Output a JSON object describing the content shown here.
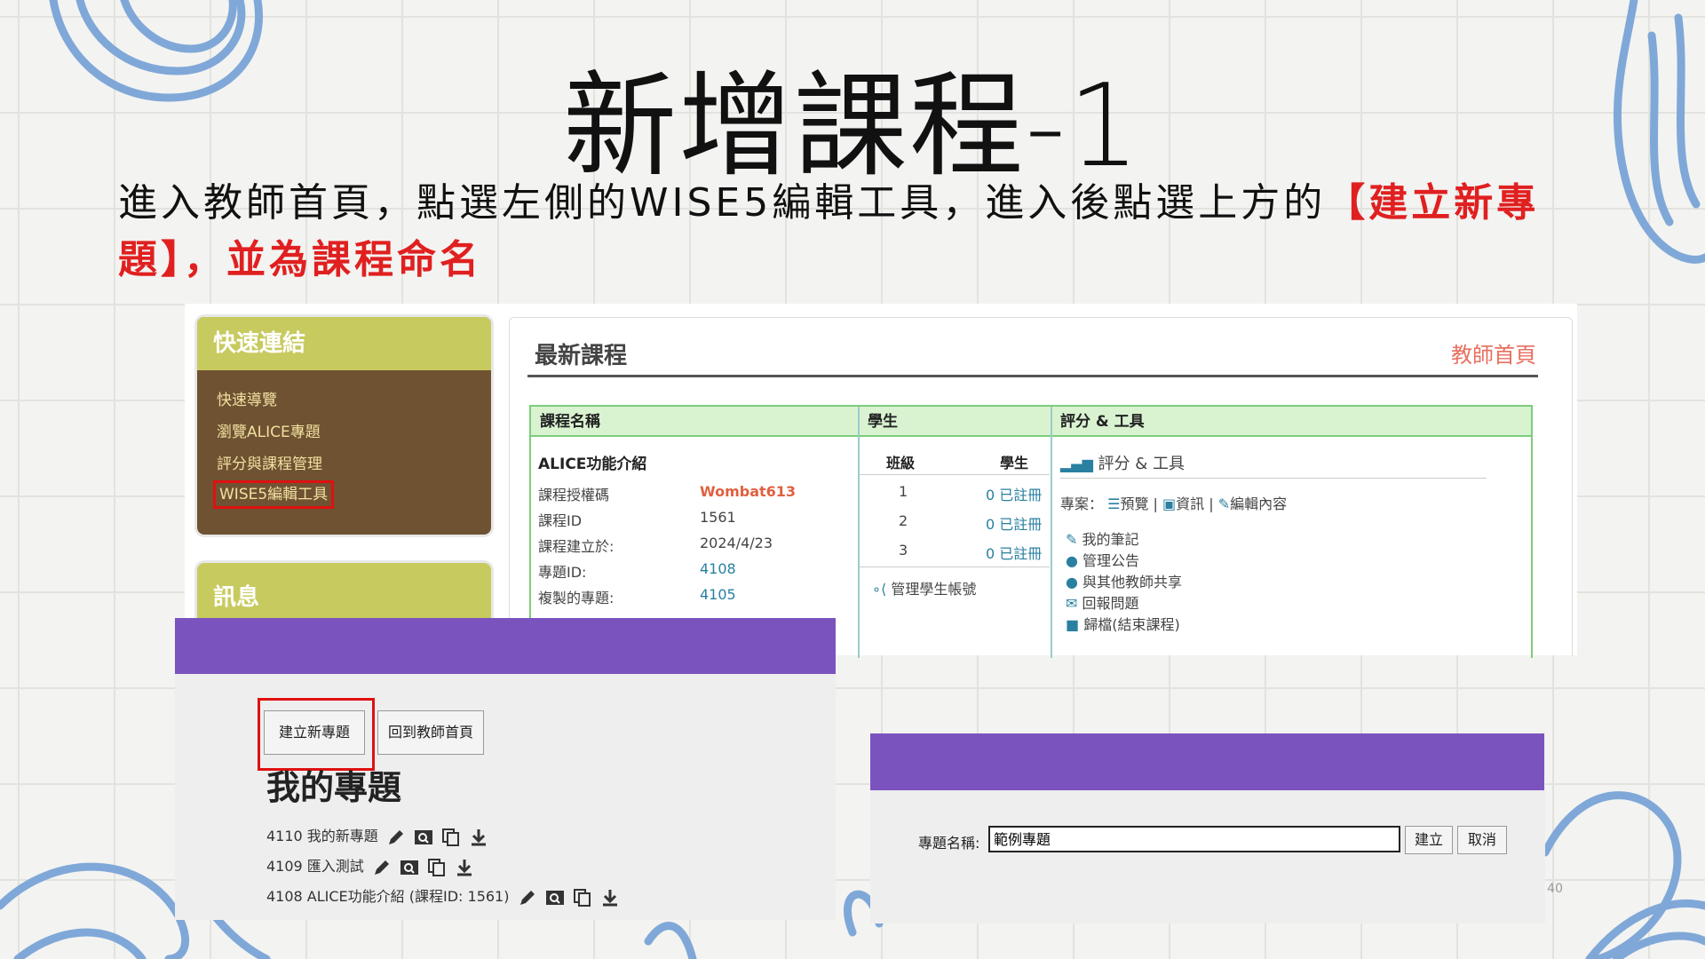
{
  "slide": {
    "title": "新增課程-1",
    "instruction_plain": "進入教師首頁，點選左側的WISE5編輯工具，進入後點選上方的",
    "instruction_highlight": "【建立新專題】，並為課程命名",
    "page_number": "40"
  },
  "quick_links": {
    "heading": "快速連結",
    "items": [
      "快速導覽",
      "瀏覽ALICE專題",
      "評分與課程管理",
      "WISE5編輯工具"
    ],
    "message_heading": "訊息"
  },
  "recent": {
    "title": "最新課程",
    "home_link": "教師首頁",
    "col_course": "課程名稱",
    "col_students": "學生",
    "col_tools": "評分 & 工具",
    "course_name": "ALICE功能介紹",
    "fields": [
      {
        "label": "課程授權碼",
        "value": "Wombat613"
      },
      {
        "label": "課程ID",
        "value": "1561"
      },
      {
        "label": "課程建立於:",
        "value": "2024/4/23"
      },
      {
        "label": "專題ID:",
        "value": "4108"
      },
      {
        "label": "複製的專題:",
        "value": "4105"
      }
    ],
    "students_sub": {
      "period": "班級",
      "students": "學生"
    },
    "periods": [
      {
        "period": "1",
        "count": "0 已註冊"
      },
      {
        "period": "2",
        "count": "0 已註冊"
      },
      {
        "period": "3",
        "count": "0 已註冊"
      }
    ],
    "manage_students": "管理學生帳號",
    "tools_header": "評分 & 工具",
    "project_label": "專案：",
    "project_links": [
      "預覽",
      "資訊",
      "編輯內容"
    ],
    "tool_links": [
      "我的筆記",
      "管理公告",
      "與其他教師共享",
      "回報問題",
      "歸檔(結束課程)"
    ]
  },
  "authoring": {
    "create_button": "建立新專題",
    "home_button": "回到教師首頁",
    "heading": "我的專題",
    "projects": [
      "4110 我的新專題",
      "4109 匯入測試",
      "4108 ALICE功能介紹 (課程ID: 1561)"
    ]
  },
  "new_project": {
    "label": "專題名稱:",
    "value": "範例專題",
    "create": "建立",
    "cancel": "取消"
  },
  "colors": {
    "accent_red": "#e02020",
    "purple": "#7b53bf",
    "olive": "#c7ca5e",
    "brown": "#6f5232"
  }
}
